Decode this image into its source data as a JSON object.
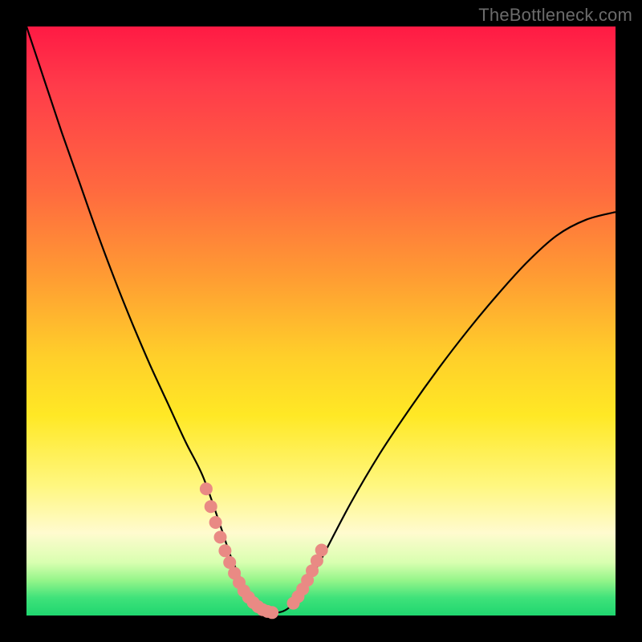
{
  "watermark": "TheBottleneck.com",
  "colors": {
    "frame": "#000000",
    "curve": "#000000",
    "highlight": "#e98a84",
    "gradient_top": "#ff1a44",
    "gradient_bottom": "#1fd66f"
  },
  "chart_data": {
    "type": "line",
    "title": "",
    "xlabel": "",
    "ylabel": "",
    "xlim": [
      0,
      100
    ],
    "ylim": [
      0,
      100
    ],
    "grid": false,
    "legend": false,
    "series": [
      {
        "name": "bottleneck-curve",
        "x": [
          0,
          3,
          6,
          9,
          12,
          15,
          18,
          21,
          24,
          27,
          30,
          33,
          34.5,
          36,
          37.5,
          39,
          40.5,
          42,
          43.5,
          45,
          47,
          50,
          55,
          60,
          65,
          70,
          75,
          80,
          85,
          90,
          95,
          100
        ],
        "y": [
          100,
          91,
          82,
          73.5,
          65,
          57,
          49.5,
          42.5,
          36,
          29.5,
          23.5,
          15,
          10.5,
          7,
          4,
          2,
          1,
          0.5,
          0.7,
          1.7,
          4,
          9.5,
          19,
          27.5,
          35,
          42,
          48.5,
          54.5,
          60,
          64.5,
          67.2,
          68.5
        ]
      }
    ],
    "highlights": [
      {
        "name": "left-leg-highlight",
        "x": [
          30.5,
          31.3,
          32.1,
          32.9,
          33.7,
          34.5,
          35.3,
          36.1,
          36.9,
          37.7,
          38.5,
          39.3,
          40.1,
          40.9,
          41.7
        ],
        "y": [
          21.5,
          18.5,
          15.8,
          13.3,
          11,
          9,
          7.2,
          5.6,
          4.2,
          3.1,
          2.2,
          1.5,
          1,
          0.7,
          0.5
        ]
      },
      {
        "name": "right-leg-highlight",
        "x": [
          45.3,
          46.1,
          46.9,
          47.7,
          48.5,
          49.3,
          50.1
        ],
        "y": [
          2.1,
          3.2,
          4.5,
          6,
          7.6,
          9.3,
          11.1
        ]
      }
    ]
  }
}
